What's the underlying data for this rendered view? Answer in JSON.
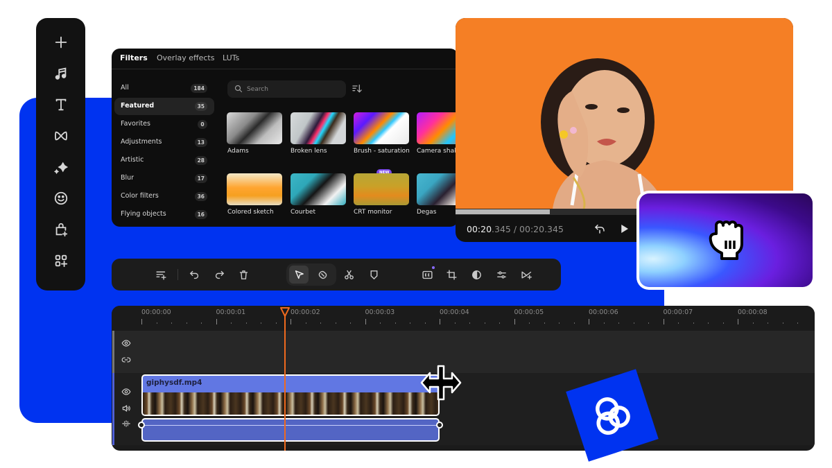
{
  "rail": {
    "items": [
      {
        "name": "add",
        "icon": "plus-icon"
      },
      {
        "name": "audio",
        "icon": "music-note-icon"
      },
      {
        "name": "text",
        "icon": "text-icon"
      },
      {
        "name": "transitions",
        "icon": "bowtie-icon"
      },
      {
        "name": "effects",
        "icon": "sparkle-icon"
      },
      {
        "name": "stickers",
        "icon": "smiley-icon"
      },
      {
        "name": "stock",
        "icon": "bag-plus-icon"
      },
      {
        "name": "apps",
        "icon": "apps-plus-icon"
      }
    ]
  },
  "filters": {
    "tabs": [
      {
        "label": "Filters",
        "active": true
      },
      {
        "label": "Overlay effects",
        "active": false
      },
      {
        "label": "LUTs",
        "active": false
      }
    ],
    "search": {
      "placeholder": "Search",
      "value": ""
    },
    "categories": [
      {
        "label": "All",
        "count": "184"
      },
      {
        "label": "Featured",
        "count": "35",
        "active": true
      },
      {
        "label": "Favorites",
        "count": "0"
      },
      {
        "label": "Adjustments",
        "count": "13"
      },
      {
        "label": "Artistic",
        "count": "28"
      },
      {
        "label": "Blur",
        "count": "17"
      },
      {
        "label": "Color filters",
        "count": "36"
      },
      {
        "label": "Flying objects",
        "count": "16"
      }
    ],
    "items": [
      {
        "label": "Adams"
      },
      {
        "label": "Broken lens"
      },
      {
        "label": "Brush - saturation"
      },
      {
        "label": "Camera shake"
      },
      {
        "label": "Colored sketch",
        "badge": "NEW"
      },
      {
        "label": "Courbet"
      },
      {
        "label": "CRT monitor"
      },
      {
        "label": "Degas"
      }
    ]
  },
  "preview": {
    "current_time_main": "00:20",
    "current_time_ms": ".345",
    "separator": " / ",
    "duration": "00:20.345",
    "progress": 0.28
  },
  "toolbar": {
    "buttons": [
      "add-track",
      "undo",
      "redo",
      "delete",
      "select",
      "slip",
      "cut",
      "marker",
      "captions",
      "crop",
      "color",
      "adjust",
      "transition"
    ]
  },
  "timeline": {
    "ticks": [
      "00:00:00",
      "00:00:01",
      "00:00:02",
      "00:00:03",
      "00:00:04",
      "00:00:05",
      "00:00:06",
      "00:00:07",
      "00:00:08"
    ],
    "playhead_seconds": 1.92,
    "clip": {
      "name": "giphysdf.mp4",
      "start_seconds": 0,
      "end_seconds": 4.0
    }
  },
  "colors": {
    "brand_blue": "#0033f0",
    "playhead": "#f06a1e",
    "clip": "#6177e3",
    "badge": "#7b4bea"
  }
}
